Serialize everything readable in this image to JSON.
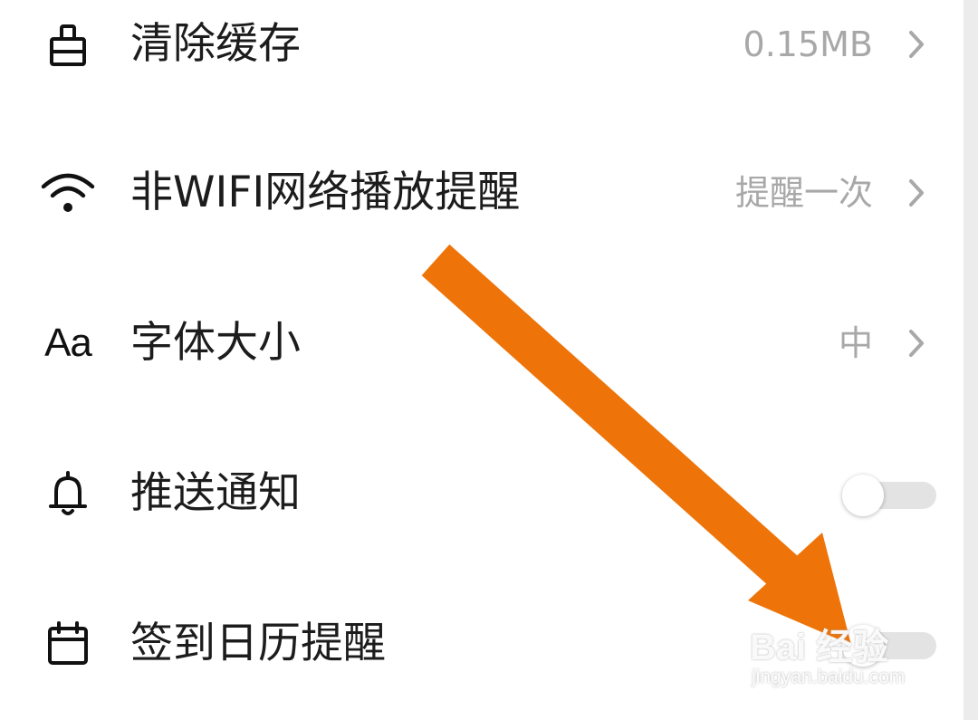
{
  "settings": {
    "items": [
      {
        "label": "清除缓存",
        "value": "0.15MB",
        "icon": "broom-icon"
      },
      {
        "label": "非WIFI网络播放提醒",
        "value": "提醒一次",
        "icon": "wifi-icon"
      },
      {
        "label": "字体大小",
        "value": "中",
        "icon": "font-size-icon",
        "icon_text": "Aa"
      },
      {
        "label": "推送通知",
        "toggle_on": false,
        "icon": "bell-icon"
      },
      {
        "label": "签到日历提醒",
        "toggle_on": false,
        "icon": "calendar-icon"
      }
    ]
  },
  "annotation": {
    "arrow_color": "#ee7308"
  },
  "watermark": {
    "brand": "Bai 经验",
    "url": "jingyan.baidu.com"
  },
  "colors": {
    "label": "#1c1c1c",
    "value": "#a8a8a8",
    "toggle_track_off": "#e3e3e3"
  }
}
